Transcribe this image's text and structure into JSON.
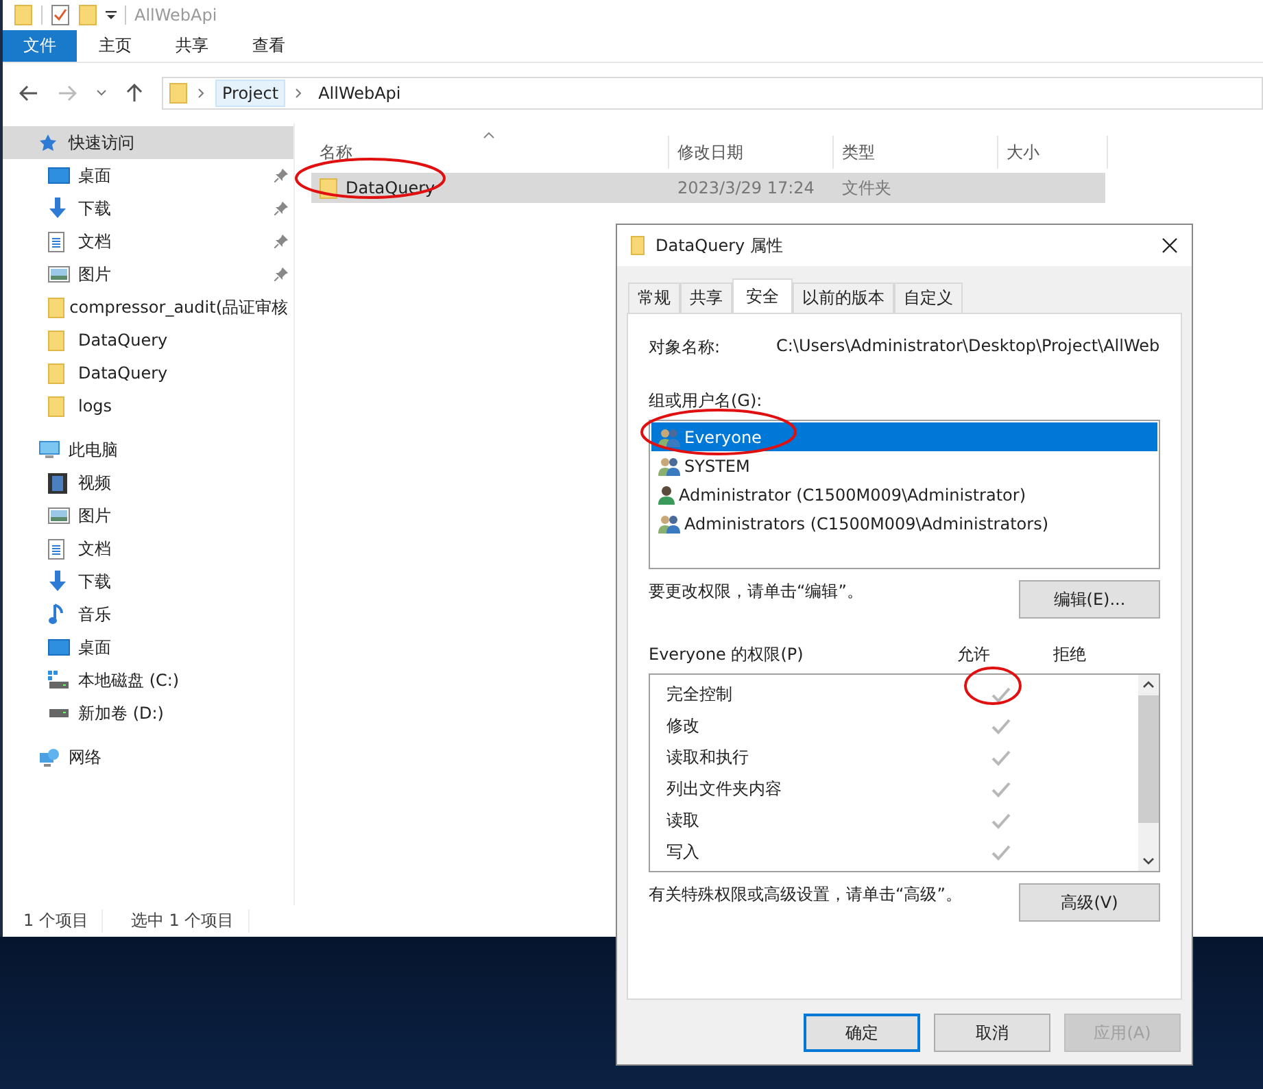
{
  "explorer": {
    "title": "AllWebApi",
    "ribbon_tabs": [
      {
        "label": "文件",
        "selected": true
      },
      {
        "label": "主页",
        "selected": false
      },
      {
        "label": "共享",
        "selected": false
      },
      {
        "label": "查看",
        "selected": false
      }
    ],
    "breadcrumb": [
      "Project",
      "AllWebApi"
    ],
    "nav_pane": [
      {
        "label": "快速访问",
        "kind": "star",
        "selected": true,
        "children": [
          {
            "label": "桌面",
            "kind": "desktop",
            "pinned": true,
            "selected": false
          },
          {
            "label": "下载",
            "kind": "download",
            "pinned": true,
            "selected": false
          },
          {
            "label": "文档",
            "kind": "document",
            "pinned": true,
            "selected": false
          },
          {
            "label": "图片",
            "kind": "picture",
            "pinned": true,
            "selected": false
          },
          {
            "label": "compressor_audit(品证审核",
            "kind": "folder",
            "pinned": false,
            "selected": false
          },
          {
            "label": "DataQuery",
            "kind": "folder",
            "pinned": false,
            "selected": false
          },
          {
            "label": "DataQuery",
            "kind": "folder",
            "pinned": false,
            "selected": false
          },
          {
            "label": "logs",
            "kind": "folder",
            "pinned": false,
            "selected": false
          }
        ]
      },
      {
        "label": "此电脑",
        "kind": "pc",
        "selected": false,
        "children": [
          {
            "label": "视频",
            "kind": "video",
            "pinned": false,
            "selected": false
          },
          {
            "label": "图片",
            "kind": "picture",
            "pinned": false,
            "selected": false
          },
          {
            "label": "文档",
            "kind": "document",
            "pinned": false,
            "selected": false
          },
          {
            "label": "下载",
            "kind": "download",
            "pinned": false,
            "selected": false
          },
          {
            "label": "音乐",
            "kind": "music",
            "pinned": false,
            "selected": false
          },
          {
            "label": "桌面",
            "kind": "desktop",
            "pinned": false,
            "selected": false
          },
          {
            "label": "本地磁盘 (C:)",
            "kind": "system_drive",
            "pinned": false,
            "selected": false
          },
          {
            "label": "新加卷 (D:)",
            "kind": "drive",
            "pinned": false,
            "selected": false
          }
        ]
      },
      {
        "label": "网络",
        "kind": "network",
        "selected": false
      }
    ],
    "columns": [
      "名称",
      "修改日期",
      "类型",
      "大小"
    ],
    "files": [
      {
        "name": "DataQuery",
        "modified": "2023/3/29 17:24",
        "type": "文件夹",
        "selected": true
      }
    ],
    "status_bar": [
      "1 个项目",
      "选中 1 个项目"
    ]
  },
  "dialog": {
    "title": "DataQuery 属性",
    "tabs": [
      {
        "label": "常规",
        "selected": false
      },
      {
        "label": "共享",
        "selected": false
      },
      {
        "label": "安全",
        "selected": true
      },
      {
        "label": "以前的版本",
        "selected": false
      },
      {
        "label": "自定义",
        "selected": false
      }
    ],
    "object_name_label": "对象名称:",
    "object_name": "C:\\Users\\Administrator\\Desktop\\Project\\AllWeb",
    "groups_label": "组或用户名(G):",
    "groups": [
      {
        "name": "Everyone",
        "kind": "group",
        "selected": true
      },
      {
        "name": "SYSTEM",
        "kind": "group",
        "selected": false
      },
      {
        "name": "Administrator (C1500M009\\Administrator)",
        "kind": "user",
        "selected": false
      },
      {
        "name": "Administrators (C1500M009\\Administrators)",
        "kind": "group",
        "selected": false
      }
    ],
    "edit_hint": "要更改权限，请单击“编辑”。",
    "edit_button": "编辑(E)...",
    "permissions_label": "Everyone 的权限(P)",
    "allow_label": "允许",
    "deny_label": "拒绝",
    "permissions": [
      {
        "name": "完全控制",
        "allow": true,
        "deny": false
      },
      {
        "name": "修改",
        "allow": true,
        "deny": false
      },
      {
        "name": "读取和执行",
        "allow": true,
        "deny": false
      },
      {
        "name": "列出文件夹内容",
        "allow": true,
        "deny": false
      },
      {
        "name": "读取",
        "allow": true,
        "deny": false
      },
      {
        "name": "写入",
        "allow": true,
        "deny": false
      }
    ],
    "advanced_hint": "有关特殊权限或高级设置，请单击“高级”。",
    "advanced_button": "高级(V)",
    "buttons": [
      {
        "label": "确定",
        "kind": "default",
        "disabled": false
      },
      {
        "label": "取消",
        "kind": "normal",
        "disabled": false
      },
      {
        "label": "应用(A)",
        "kind": "normal",
        "disabled": true
      }
    ]
  }
}
